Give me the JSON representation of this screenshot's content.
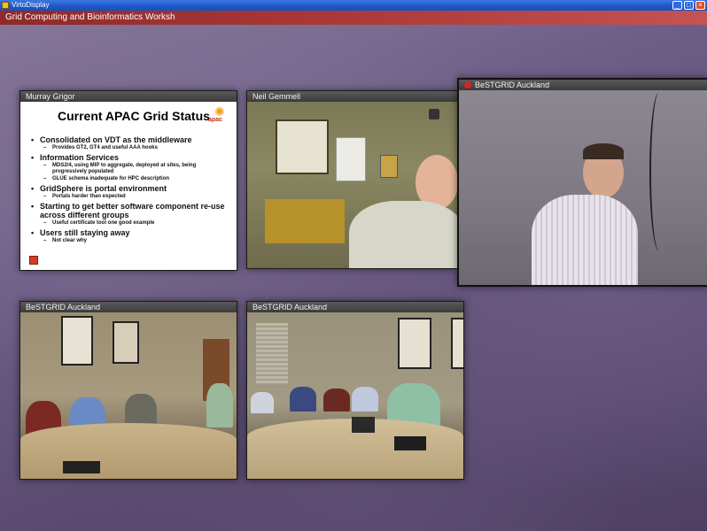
{
  "window": {
    "title": "VirtoDisplay",
    "minimize": "_",
    "maximize": "□",
    "close": "×",
    "icon": "app-icon"
  },
  "session": {
    "title": "Grid Computing and Bioinformatics Worksh"
  },
  "panels": {
    "slide": {
      "label": "Murray Grigor"
    },
    "presenter": {
      "label": "Neil Gemmell"
    },
    "speaker": {
      "label": "BeSTGRID Auckland"
    },
    "room_left": {
      "label": "BeSTGRID Auckland"
    },
    "room_right": {
      "label": "BeSTGRID Auckland"
    }
  },
  "slide": {
    "title": "Current APAC Grid Status",
    "logo_text": "apac",
    "bullets": [
      {
        "text": "Consolidated on VDT as the middleware",
        "level": 1
      },
      {
        "text": "Provides GT2, GT4 and useful AAA hooks",
        "level": 2
      },
      {
        "text": "Information Services",
        "level": 1
      },
      {
        "text": "MDS2/4, using MIP to aggregate, deployed at sites, being progressively populated",
        "level": 2
      },
      {
        "text": "GLUE schema inadequate for HPC description",
        "level": 2
      },
      {
        "text": "GridSphere is portal environment",
        "level": 1
      },
      {
        "text": "Portals harder than expected",
        "level": 2
      },
      {
        "text": "Starting to get better software component re-use across different groups",
        "level": 1
      },
      {
        "text": "Useful certificate tool one good example",
        "level": 2
      },
      {
        "text": "Users still staying away",
        "level": 1
      },
      {
        "text": "Not clear why",
        "level": 2
      }
    ]
  },
  "colors": {
    "titlebar": "#1f57c8",
    "session_bar": "#a83838",
    "panel_label": "#3b3b3b",
    "background": "#6d5e86"
  }
}
